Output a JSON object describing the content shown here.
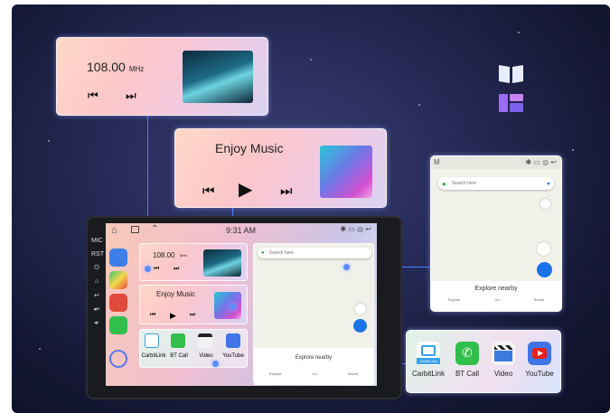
{
  "radio": {
    "frequency": "108.00",
    "unit": "MHz"
  },
  "music": {
    "title": "Enjoy Music"
  },
  "device": {
    "time": "9:31 AM",
    "side_keys": [
      "MIC",
      "RST",
      "⏻",
      "⌂",
      "↩",
      "◂+",
      "◂-"
    ]
  },
  "map": {
    "status_letter": "M",
    "search_placeholder": "Search here",
    "explore_label": "Explore nearby",
    "nav_items": [
      "Explore",
      "Go",
      "Saved"
    ]
  },
  "apps": [
    {
      "label": "CarbitLink",
      "badge": "Carbit Link"
    },
    {
      "label": "BT Call"
    },
    {
      "label": "Video"
    },
    {
      "label": "YouTube"
    }
  ],
  "mini_apps": [
    "CarbitLink",
    "BT Call",
    "Video",
    "YouTube"
  ],
  "colors": {
    "accent": "#4c7dff",
    "map_button": "#1a73e8",
    "background": "#1d2046"
  }
}
